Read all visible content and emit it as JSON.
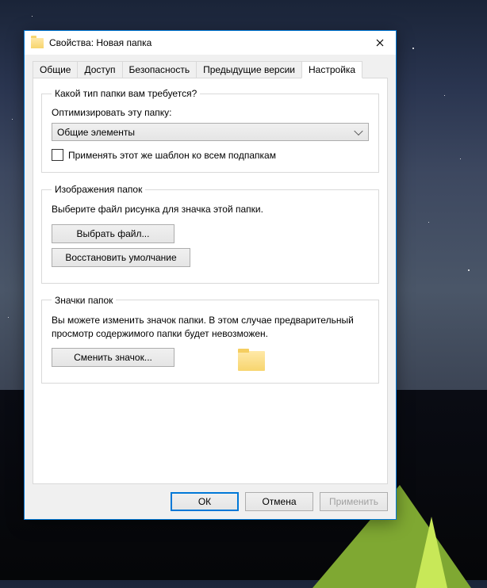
{
  "window": {
    "title": "Свойства: Новая папка"
  },
  "tabs": [
    {
      "label": "Общие"
    },
    {
      "label": "Доступ"
    },
    {
      "label": "Безопасность"
    },
    {
      "label": "Предыдущие версии"
    },
    {
      "label": "Настройка",
      "active": true
    }
  ],
  "folderType": {
    "legend": "Какой тип папки вам требуется?",
    "optimizeLabel": "Оптимизировать эту папку:",
    "selected": "Общие элементы",
    "applyToSubfolders": "Применять этот же шаблон ко всем подпапкам"
  },
  "folderImages": {
    "legend": "Изображения папок",
    "description": "Выберите файл рисунка для значка этой папки.",
    "chooseFile": "Выбрать файл...",
    "restoreDefault": "Восстановить умолчание"
  },
  "folderIcons": {
    "legend": "Значки папок",
    "description": "Вы можете изменить значок папки. В этом случае предварительный просмотр содержимого папки будет невозможен.",
    "changeIcon": "Сменить значок..."
  },
  "buttons": {
    "ok": "ОК",
    "cancel": "Отмена",
    "apply": "Применить"
  }
}
